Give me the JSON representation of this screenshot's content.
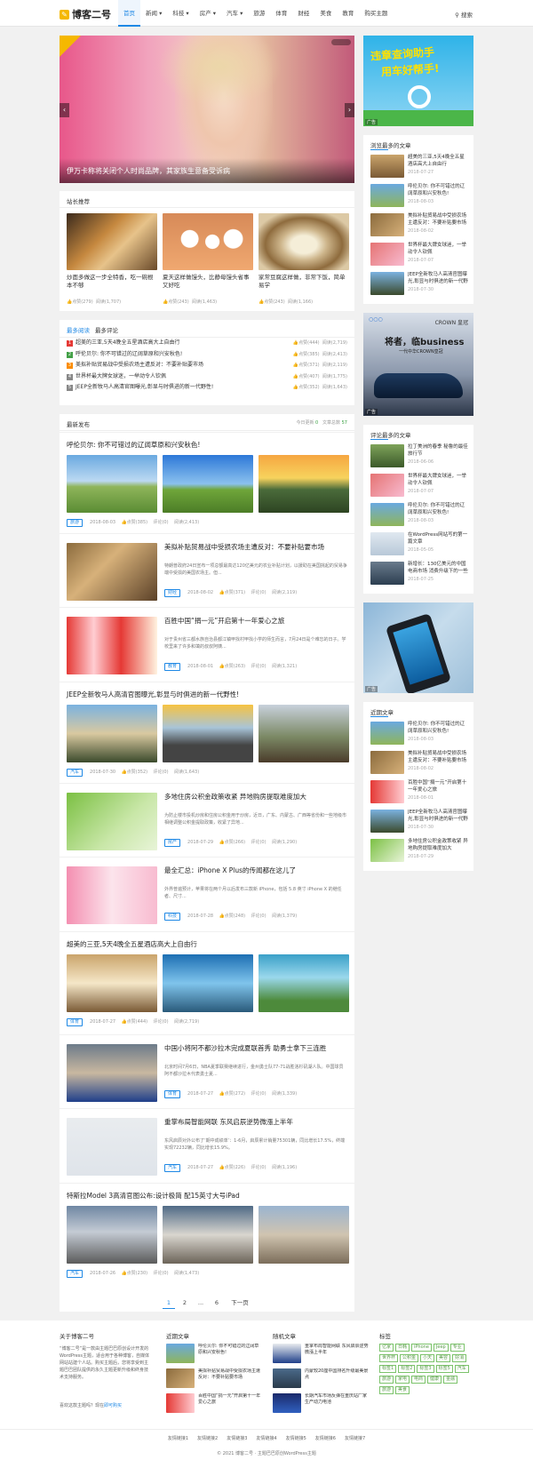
{
  "header": {
    "logo": "博客二号",
    "nav": [
      "首页",
      "新闻",
      "科技",
      "房产",
      "汽车",
      "旅游",
      "体育",
      "财经",
      "美食",
      "教育",
      "购买主题"
    ],
    "search": "搜索"
  },
  "slider": {
    "caption": "伊万卡称将关闭个人时尚品牌，其家族生意备受诉病"
  },
  "ad_top": {
    "title": "违章查询助手",
    "sub": "用车好帮手!",
    "badge": "广告"
  },
  "recommend": {
    "title": "站长推荐",
    "items": [
      {
        "title": "炒面多做这一步全特香，吃一碗根本不够",
        "likes": "点赞(279)",
        "views": "阅读(1,707)"
      },
      {
        "title": "夏天这样做馒头，比静母馒头省事又好吃",
        "likes": "点赞(243)",
        "views": "阅读(1,463)"
      },
      {
        "title": "家常豆腐这样做，非常下饭，简单易学",
        "likes": "点赞(243)",
        "views": "阅读(1,166)"
      }
    ]
  },
  "tabs": {
    "tab1": "最多阅读",
    "tab2": "最多评论",
    "items": [
      {
        "n": "1",
        "t": "超美的三亚,5天4晚全五星酒店高大上自由行",
        "likes": "点赞(444)",
        "views": "阅读(2,719)"
      },
      {
        "n": "2",
        "t": "呼伦贝尔: 你不可错过的辽阔草原和兴安秋色!",
        "likes": "点赞(385)",
        "views": "阅读(2,413)"
      },
      {
        "n": "3",
        "t": "美拟补贴贸易战中受损农场主遭反对：不要补贴要市场",
        "likes": "点赞(371)",
        "views": "阅读(2,119)"
      },
      {
        "n": "4",
        "t": "世界杯最大牌女球迷，一举动令人钦佩",
        "likes": "点赞(407)",
        "views": "阅读(1,775)"
      },
      {
        "n": "5",
        "t": "JEEP全新牧马人高清官图曝光,彰显与时俱进的新一代野性!",
        "likes": "点赞(352)",
        "views": "阅读(1,643)"
      }
    ]
  },
  "latest": {
    "title": "最新发布",
    "today_label": "今日更新",
    "today_n": "0",
    "total_label": "文章总数",
    "total_n": "57"
  },
  "posts": [
    {
      "title": "呼伦贝尔: 你不可错过的辽阔草原和兴安秋色!",
      "tag": "旅游",
      "date": "2018-08-03",
      "likes": "点赞(385)",
      "comments": "评论(0)",
      "views": "阅读(2,413)"
    },
    {
      "title": "美拟补贴贸易战中受损农场主遭反对：不要补贴要市场",
      "excerpt": "特朗普政府24日宣布一项总额最高达120亿美元的农业补贴计划，以援助在美国挑起的贸易争端中受损的美国农场主。但...",
      "tag": "财经",
      "date": "2018-08-02",
      "likes": "点赞(371)",
      "comments": "评论(0)",
      "views": "阅读(2,119)"
    },
    {
      "title": "百胜中国“捐一元”开启第十一年爱心之旅",
      "excerpt": "对于贵州省三都水族自治县都江镇甲找村甲找小学的师生而言，7月24日是个难忘的日子。学校里来了许多和蔼的叔叔阿姨...",
      "tag": "教育",
      "date": "2018-08-01",
      "likes": "点赞(263)",
      "comments": "评论(0)",
      "views": "阅读(1,321)"
    },
    {
      "title": "JEEP全新牧马人高清官图曝光,彰显与时俱进的新一代野性!",
      "tag": "汽车",
      "date": "2018-07-30",
      "likes": "点赞(352)",
      "comments": "评论(0)",
      "views": "阅读(1,643)"
    },
    {
      "title": "多地住房公积金政策收紧 异地购房提取难度加大",
      "excerpt": "为防止楼市投机炒房和住房公积金用于炒房，近日，广东、内蒙古、广西等省份和一些地级市相继调整公积金提取政策，收紧了异地...",
      "tag": "房产",
      "date": "2018-07-29",
      "likes": "点赞(266)",
      "comments": "评论(0)",
      "views": "阅读(1,290)"
    },
    {
      "title": "最全汇总：iPhone X Plus的传闻都在这儿了",
      "excerpt": "外界普遍预计，苹果将在两个月以后发布三款新 iPhone，包括 5.8 英寸 iPhone X 的继任者、尺寸...",
      "tag": "科技",
      "date": "2018-07-28",
      "likes": "点赞(248)",
      "comments": "评论(0)",
      "views": "阅读(1,379)"
    },
    {
      "title": "超美的三亚,5天4晚全五星酒店高大上自由行",
      "tag": "体育",
      "date": "2018-07-27",
      "likes": "点赞(444)",
      "comments": "评论(0)",
      "views": "阅读(2,719)"
    },
    {
      "title": "中国小将阿不都沙拉木完成夏联首秀 助勇士拿下三连胜",
      "excerpt": "北京时间7月6日，NBA夏季联赛继续进行，金州勇士队77-71战胜洛杉矶湖人队。中国球员阿不都沙拉木代表勇士夏...",
      "tag": "体育",
      "date": "2018-07-27",
      "likes": "点赞(272)",
      "comments": "评论(0)",
      "views": "阅读(1,339)"
    },
    {
      "title": "重掌布局智能网联 东风启辰逆势微漲上半年",
      "excerpt": "东风启辰对外公布了‘期中成绩单’：1-6月，启辰累计销量75301辆，同比增长17.5%，终端实现72232辆，同比增长15.9%。",
      "tag": "汽车",
      "date": "2018-07-27",
      "likes": "点赞(226)",
      "comments": "评论(0)",
      "views": "阅读(1,196)"
    },
    {
      "title": "特斯拉Model 3高清官图公布:设计极简 配15英寸大号iPad",
      "tag": "汽车",
      "date": "2018-07-26",
      "likes": "点赞(230)",
      "comments": "评论(0)",
      "views": "阅读(1,473)"
    }
  ],
  "pagination": {
    "p1": "1",
    "p2": "2",
    "dots": "...",
    "p6": "6",
    "next": "下一页"
  },
  "side_hot": {
    "title": "浏览最多的文章",
    "items": [
      {
        "t": "超美的三亚,5天4晚全五星酒店高大上自由行",
        "d": "2018-07-27"
      },
      {
        "t": "呼伦贝尔: 你不可错过的辽阔草原和兴安秋色!",
        "d": "2018-08-03"
      },
      {
        "t": "美拟补贴贸易战中受损农场主遭反对：不要补贴要市场",
        "d": "2018-08-02"
      },
      {
        "t": "世界杯最大牌女球迷，一举动令人钦佩",
        "d": "2018-07-07"
      },
      {
        "t": "JEEP全新牧马人高清官图曝光,彰显与时俱进的新一代野性!",
        "d": "2018-07-30"
      }
    ]
  },
  "ad_car": {
    "line1": "将者，临businesses",
    "line2": "一代中华CROWN皇冠",
    "brand": "CROWN 皇冠",
    "badge": "广告"
  },
  "side_comm": {
    "title": "评论最多的文章",
    "items": [
      {
        "t": "拉丁美洲的春季 秘鲁的最佳旅行节",
        "d": "2018-06-06"
      },
      {
        "t": "世界杯最大牌女球迷，一举动令人钦佩",
        "d": "2018-07-07"
      },
      {
        "t": "呼伦贝尔: 你不可错过的辽阔草原和兴安秋色!",
        "d": "2018-08-03"
      },
      {
        "t": "在WordPress网站写的第一篇文章",
        "d": "2018-05-05"
      },
      {
        "t": "新增长：130亿美元的中国电商市场 消费升级下的一些问题",
        "d": "2018-07-25"
      }
    ]
  },
  "ad_phone": {
    "badge": "广告"
  },
  "side_recent": {
    "title": "近期文章",
    "items": [
      {
        "t": "呼伦贝尔: 你不可错过的辽阔草原和兴安秋色!",
        "d": "2018-08-03"
      },
      {
        "t": "美拟补贴贸易战中受损农场主遭反对：不要补贴要市场",
        "d": "2018-08-02"
      },
      {
        "t": "百胜中国“捐一元”开启第十一年爱心之旅",
        "d": "2018-08-01"
      },
      {
        "t": "JEEP全新牧马人高清官图曝光,彰显与时俱进的新一代野性!",
        "d": "2018-07-30"
      },
      {
        "t": "多地住房公积金政策收紧 异地购房提取难度加大",
        "d": "2018-07-29"
      }
    ]
  },
  "footer": {
    "about_title": "关于博客二号",
    "about_text": "“博客二号”是一款由主题巴巴原创设计开发的WordPress主题，适合用于各种博客，自媒体网站站建个人站。购买主题后，您将享受到主题巴巴团队提供的永久主题更新升级和终身技术支持服务。",
    "about_q": "喜欢这款主题吗？现在",
    "about_link": "即可购买",
    "recent_title": "近期文章",
    "recent": [
      "呼伦贝尔: 你不可错过的辽阔草原和兴安秋色!",
      "美拟补贴贸易战中受损农场主遭反对：不要补贴要市场",
      "百胜中国“捐一元”开启第十一年爱心之旅"
    ],
    "random_title": "随机文章",
    "random": [
      "重掌布局智能网联 东风启辰逆势微漲上半年",
      "内蒙较20座中国排名升级最美景点",
      "长期汽车市场反弹在重庆站厂家生产动力电池"
    ],
    "tags_title": "标签",
    "tags": [
      "亿家",
      "日韩",
      "iPhone",
      "Jeep",
      "专业",
      "世界杯",
      "公积金",
      "小天",
      "美容",
      "好消",
      "标签1",
      "标签2",
      "标签3",
      "标签5",
      "汽车",
      "旅游",
      "家电",
      "电商",
      "健康",
      "金融",
      "旅游",
      "美食"
    ],
    "links": [
      "友情链接1",
      "友情链接2",
      "友情链接3",
      "友情链接4",
      "友情链接5",
      "友情链接6",
      "友情链接7"
    ],
    "copy": "© 2021 博客二号 · 主题巴巴原创WordPress主题"
  }
}
